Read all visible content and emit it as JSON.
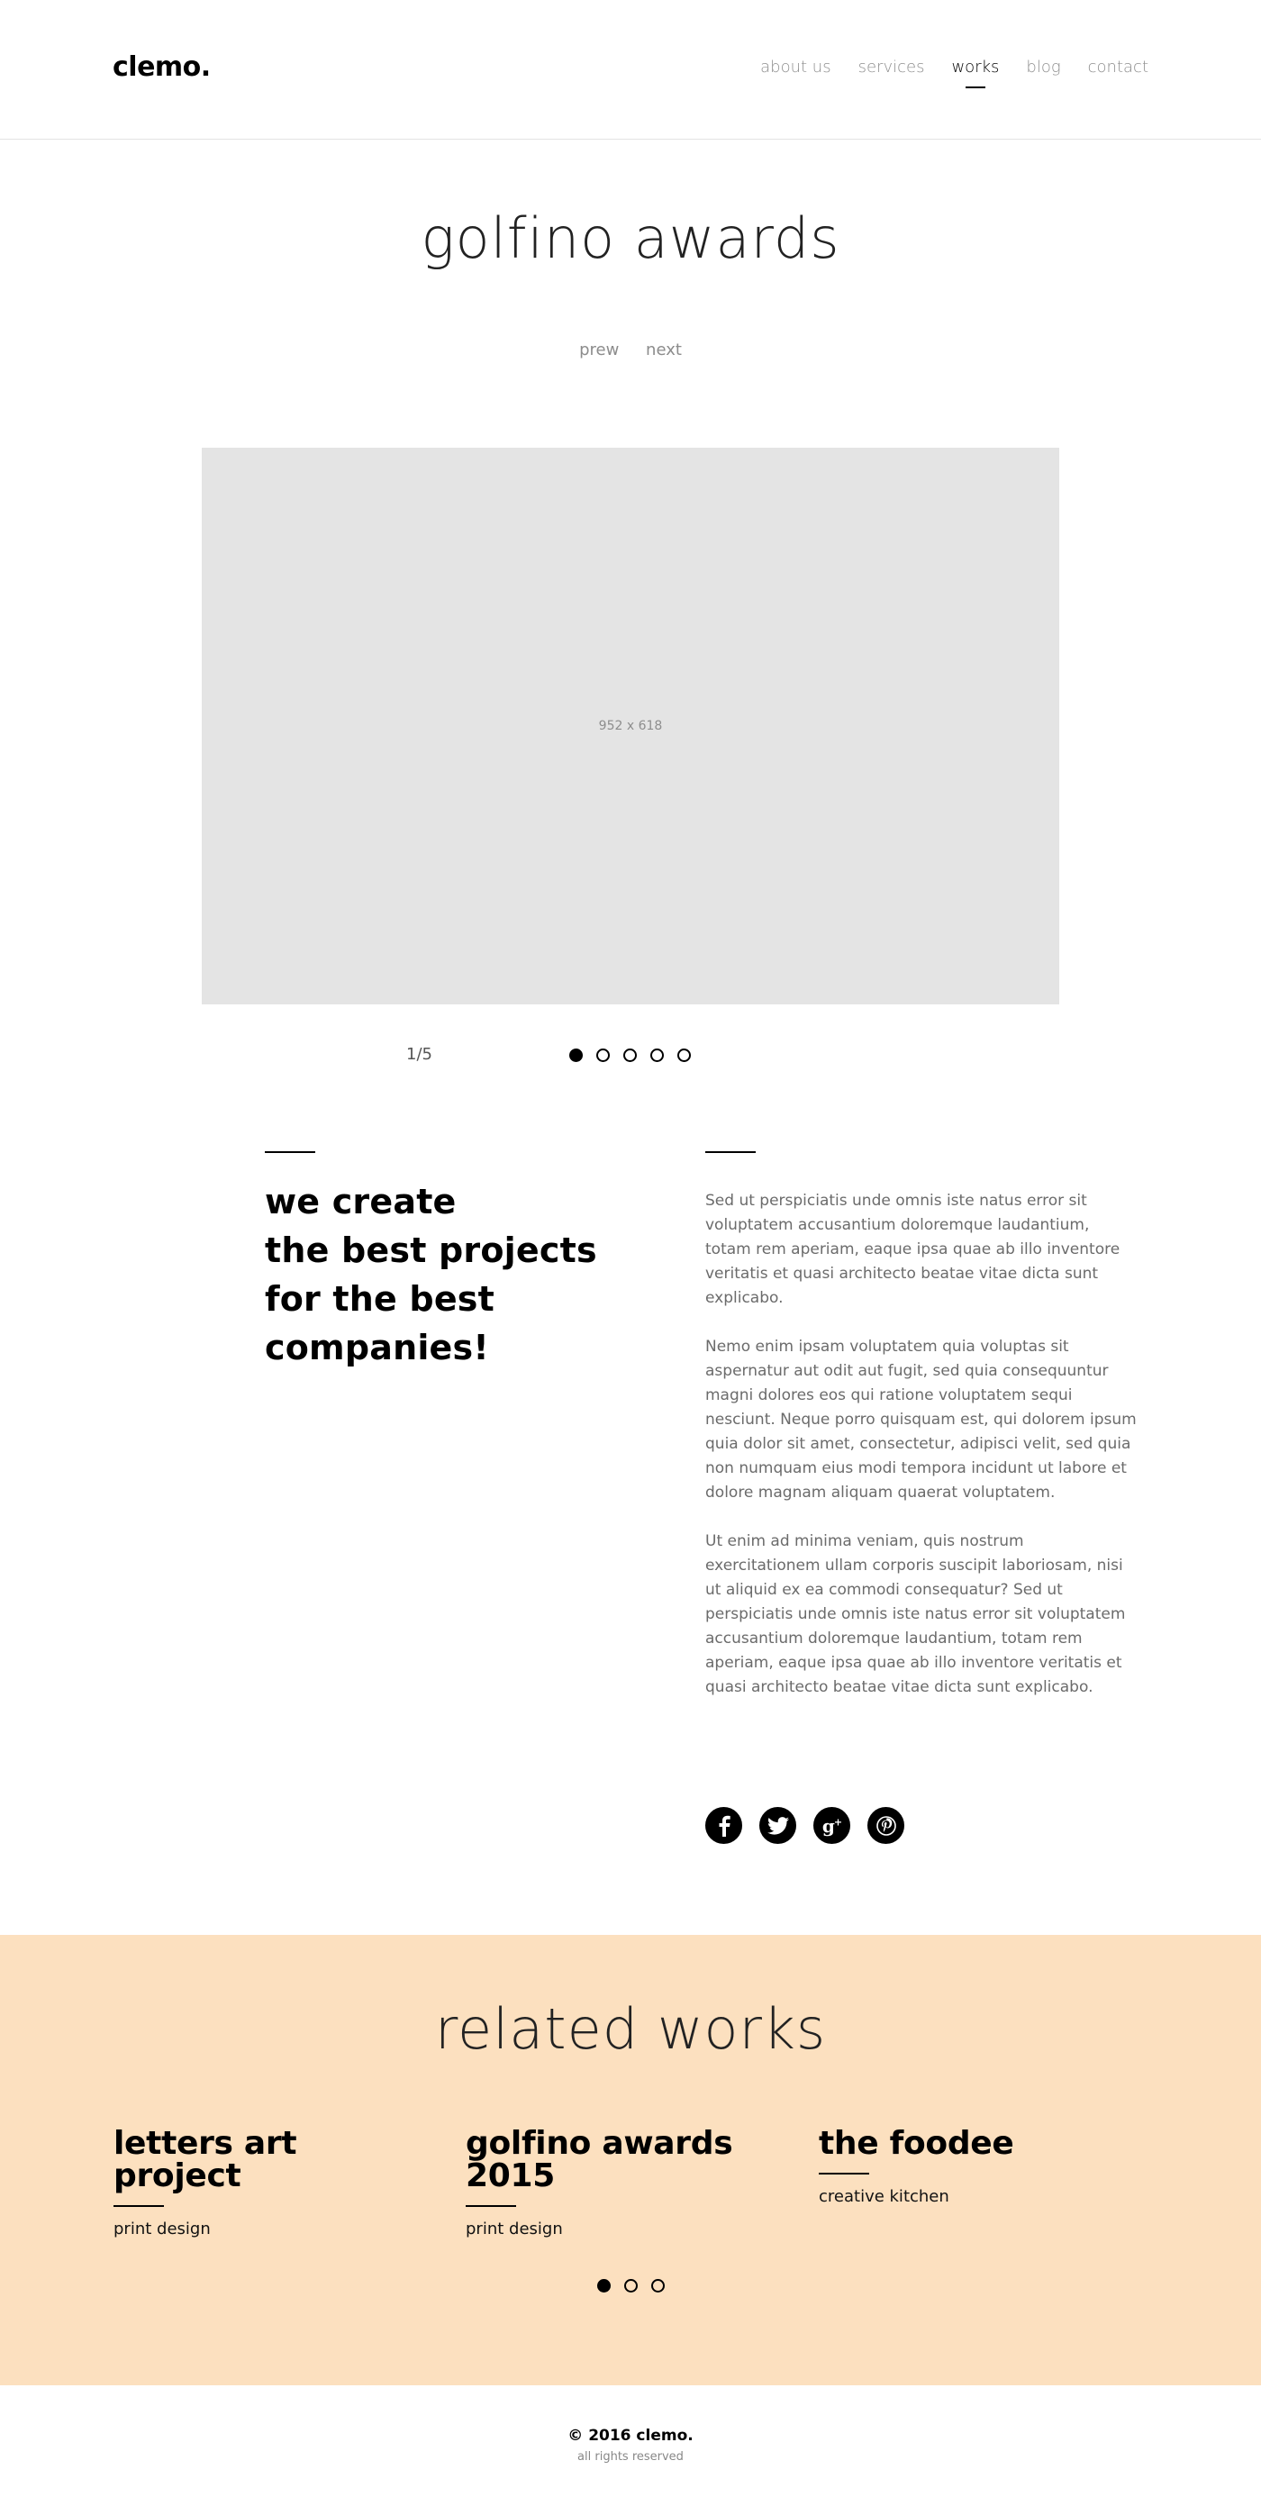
{
  "header": {
    "logo": "clemo.",
    "nav": [
      {
        "label": "about us",
        "active": false
      },
      {
        "label": "services",
        "active": false
      },
      {
        "label": "works",
        "active": true
      },
      {
        "label": "blog",
        "active": false
      },
      {
        "label": "contact",
        "active": false
      }
    ]
  },
  "project": {
    "title": "golfino awards",
    "prev_label": "prew",
    "next_label": "next",
    "image_placeholder": "952 x 618",
    "slide_counter": "1/5",
    "slide_count": 5,
    "active_slide": 1
  },
  "about": {
    "tagline": [
      "we create",
      "the best projects",
      "for the best",
      "companies!"
    ],
    "paragraphs": [
      "Sed ut perspiciatis unde omnis iste natus error sit voluptatem accusantium doloremque laudantium, totam rem aperiam, eaque ipsa quae ab illo inventore veritatis et quasi architecto beatae vitae dicta sunt explicabo.",
      "Nemo enim ipsam voluptatem quia voluptas sit aspernatur aut odit aut fugit, sed quia consequuntur magni dolores eos qui ratione voluptatem sequi nesciunt. Neque porro quisquam est, qui dolorem ipsum quia dolor sit amet, consectetur, adipisci velit, sed quia non numquam eius modi tempora incidunt ut labore et dolore magnam aliquam quaerat voluptatem.",
      "Ut enim ad minima veniam, quis nostrum exercitationem ullam corporis suscipit laboriosam, nisi ut aliquid ex ea commodi consequatur? Sed ut perspiciatis unde omnis iste natus error sit voluptatem accusantium doloremque laudantium, totam rem aperiam, eaque ipsa quae ab illo inventore veritatis et quasi architecto beatae vitae dicta sunt explicabo."
    ],
    "social": [
      "facebook-icon",
      "twitter-icon",
      "google-plus-icon",
      "pinterest-icon"
    ]
  },
  "related": {
    "title": "related works",
    "background": "#fce0bf",
    "works": [
      {
        "title": "letters art project",
        "category": "print design"
      },
      {
        "title": "golfino awards 2015",
        "category": "print design"
      },
      {
        "title": "the foodee",
        "category": "creative kitchen"
      }
    ],
    "page_count": 3,
    "active_page": 1
  },
  "footer": {
    "copyright": "© 2016 clemo.",
    "rights": "all rights reserved"
  }
}
